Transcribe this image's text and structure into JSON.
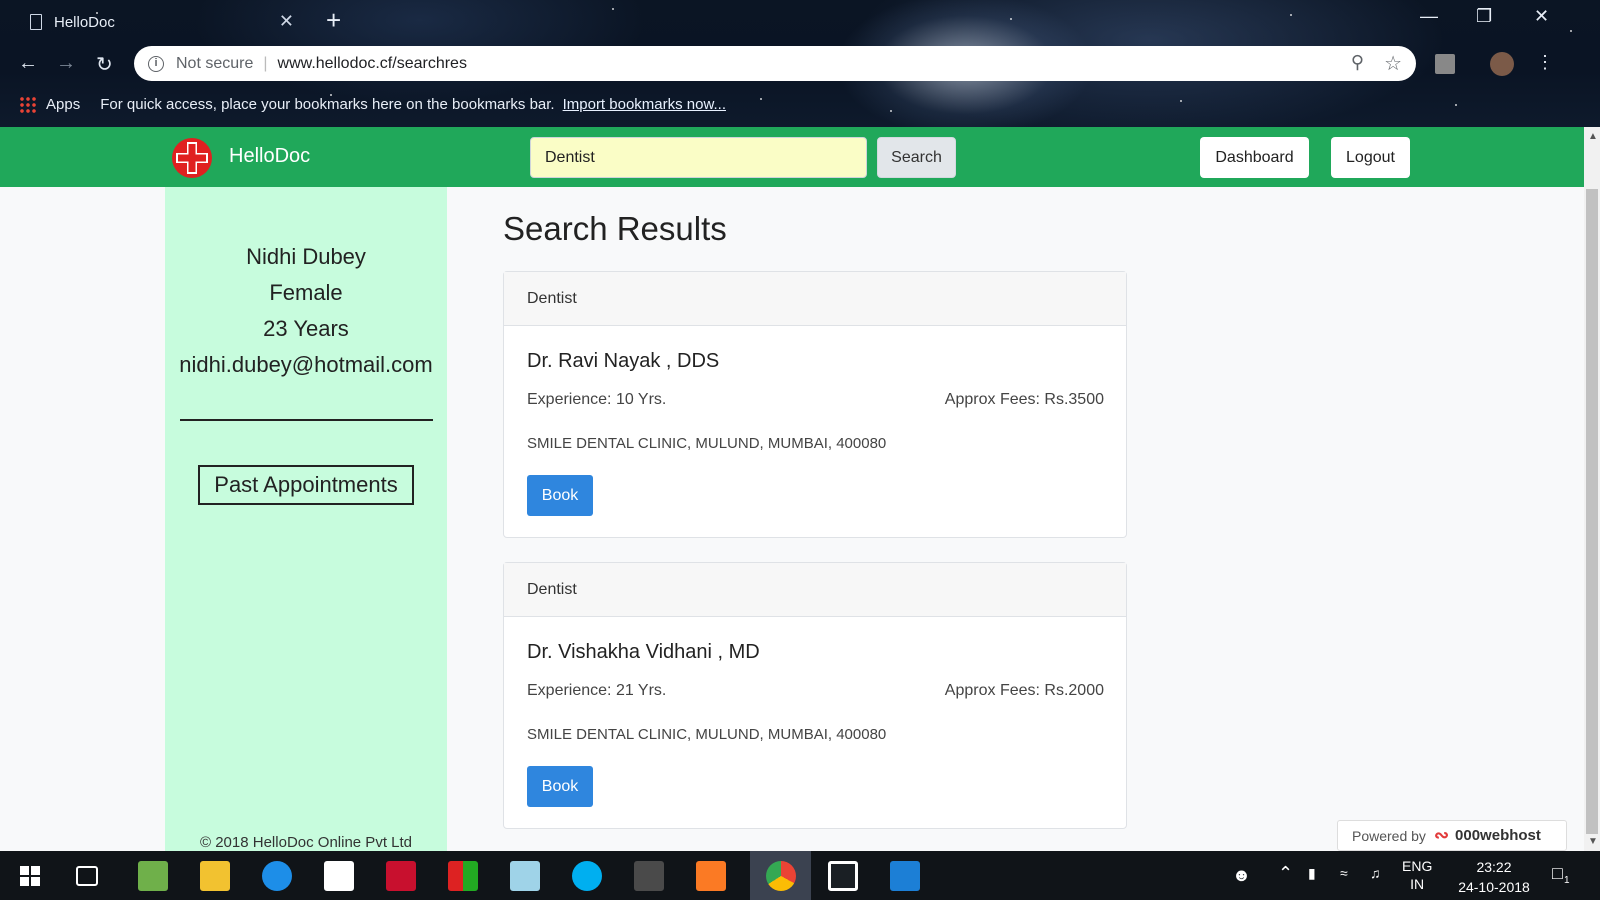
{
  "browser": {
    "tab_title": "HelloDoc",
    "tab_close": "✕",
    "new_tab": "+",
    "not_secure": "Not secure",
    "url": "www.hellodoc.cf/searchres",
    "bookmarks_apps": "Apps",
    "bookmarks_hint": "For quick access, place your bookmarks here on the bookmarks bar.",
    "bookmarks_link": "Import bookmarks now..."
  },
  "navbar": {
    "brand": "HelloDoc",
    "search_value": "Dentist",
    "search_button": "Search",
    "dashboard_button": "Dashboard",
    "logout_button": "Logout",
    "color": "#20a85a"
  },
  "sidebar": {
    "name": "Nidhi Dubey",
    "gender": "Female",
    "age": "23 Years",
    "email": "nidhi.dubey@hotmail.com",
    "past_appointments": "Past Appointments",
    "footer": "© 2018 HelloDoc Online Pvt Ltd"
  },
  "main": {
    "title": "Search Results",
    "results": [
      {
        "specialty": "Dentist",
        "doctor": "Dr. Ravi Nayak , DDS",
        "experience": "Experience: 10 Yrs.",
        "fees": "Approx Fees: Rs.3500",
        "address": "SMILE DENTAL CLINIC, MULUND, MUMBAI, 400080",
        "book": "Book"
      },
      {
        "specialty": "Dentist",
        "doctor": "Dr. Vishakha Vidhani , MD",
        "experience": "Experience: 21 Yrs.",
        "fees": "Approx Fees: Rs.2000",
        "address": "SMILE DENTAL CLINIC, MULUND, MUMBAI, 400080",
        "book": "Book"
      }
    ],
    "powered_by": "Powered by",
    "powered_brand": "000webhost"
  },
  "taskbar": {
    "lang_top": "ENG",
    "lang_bottom": "IN",
    "time": "23:22",
    "date": "24-10-2018",
    "notifications": "1"
  }
}
